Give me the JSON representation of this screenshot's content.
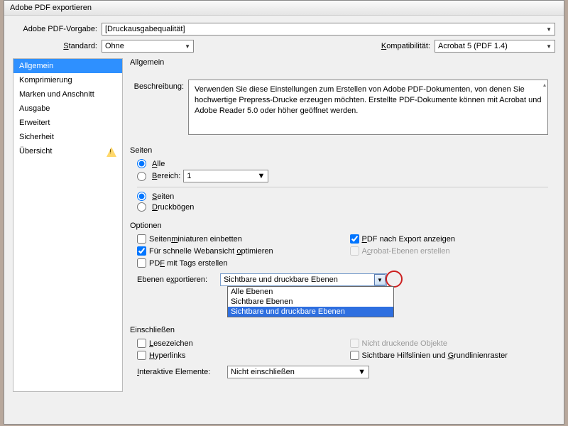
{
  "window": {
    "title": "Adobe PDF exportieren"
  },
  "preset": {
    "label": "Adobe PDF-Vorgabe:",
    "value": "[Druckausgabequalität]"
  },
  "standard": {
    "label": "Standard:",
    "value": "Ohne"
  },
  "compat": {
    "label": "Kompatibilität:",
    "value": "Acrobat 5 (PDF 1.4)"
  },
  "sidebar": {
    "items": [
      {
        "label": "Allgemein",
        "active": true
      },
      {
        "label": "Komprimierung"
      },
      {
        "label": "Marken und Anschnitt"
      },
      {
        "label": "Ausgabe"
      },
      {
        "label": "Erweitert"
      },
      {
        "label": "Sicherheit"
      },
      {
        "label": "Übersicht",
        "warn": true
      }
    ]
  },
  "panel": {
    "title": "Allgemein",
    "desc_label": "Beschreibung:",
    "desc_text": "Verwenden Sie diese Einstellungen zum Erstellen von Adobe PDF-Dokumenten, von denen Sie hochwertige Prepress-Drucke erzeugen möchten. Erstellte PDF-Dokumente können mit Acrobat und Adobe Reader 5.0 oder höher geöffnet werden."
  },
  "pages": {
    "title": "Seiten",
    "all": "Alle",
    "range": "Bereich:",
    "range_value": "1",
    "pages_radio": "Seiten",
    "spreads": "Druckbögen"
  },
  "options": {
    "title": "Optionen",
    "thumbnails": "Seitenminiaturen einbetten",
    "view_after": "PDF nach Export anzeigen",
    "fast_web": "Für schnelle Webansicht optimieren",
    "acrobat_layers": "Acrobat-Ebenen erstellen",
    "tagged": "PDF mit Tags erstellen",
    "export_layers_label": "Ebenen exportieren:",
    "export_layers_value": "Sichtbare und druckbare Ebenen",
    "dropdown": [
      "Alle Ebenen",
      "Sichtbare Ebenen",
      "Sichtbare und druckbare Ebenen"
    ]
  },
  "include": {
    "title": "Einschließen",
    "bookmarks": "Lesezeichen",
    "nonprinting": "Nicht druckende Objekte",
    "hyperlinks": "Hyperlinks",
    "guides": "Sichtbare Hilfslinien und Grundlinienraster"
  },
  "interactive": {
    "label": "Interaktive Elemente:",
    "value": "Nicht einschließen"
  }
}
